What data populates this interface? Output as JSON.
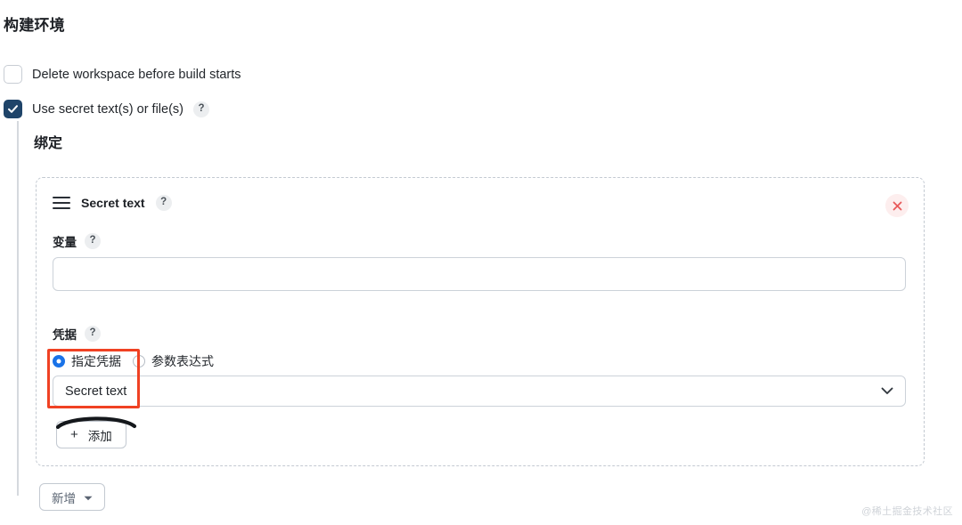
{
  "page": {
    "title": "构建环境",
    "watermark": "@稀土掘金技术社区"
  },
  "options": [
    {
      "label": "Delete workspace before build starts",
      "checked": false,
      "has_help": false,
      "icon": "checkbox-unchecked-icon"
    },
    {
      "label": "Use secret text(s) or file(s)",
      "checked": true,
      "has_help": true,
      "help_label": "?",
      "icon": "checkbox-checked-icon"
    }
  ],
  "binding": {
    "section_title": "绑定",
    "entry": {
      "drag_handle_icon": "drag-handle-icon",
      "title": "Secret text",
      "help_label": "?",
      "close_icon": "close-icon",
      "variable": {
        "label": "变量",
        "help_label": "?",
        "value": "",
        "placeholder": ""
      },
      "credential": {
        "label": "凭据",
        "help_label": "?",
        "radios": [
          {
            "label": "指定凭据",
            "selected": true
          },
          {
            "label": "参数表达式",
            "selected": false
          }
        ],
        "select": {
          "value": "Secret text",
          "caret_icon": "chevron-down-icon"
        }
      },
      "add_button": {
        "plus_icon": "plus-icon",
        "label": "添加"
      }
    },
    "new_button": {
      "label": "新增",
      "caret_icon": "caret-down-icon"
    }
  },
  "colors": {
    "checkbox_checked": "#1f4469",
    "radio_selected": "#1a73e8",
    "annotation_red": "#f04123",
    "close_icon": "#e8595a",
    "close_bg": "#fdeeee",
    "dashed_border": "#c3c9d1",
    "input_border": "#ccd2d9",
    "text": "#23272c",
    "watermark": "#cfd3d8"
  }
}
